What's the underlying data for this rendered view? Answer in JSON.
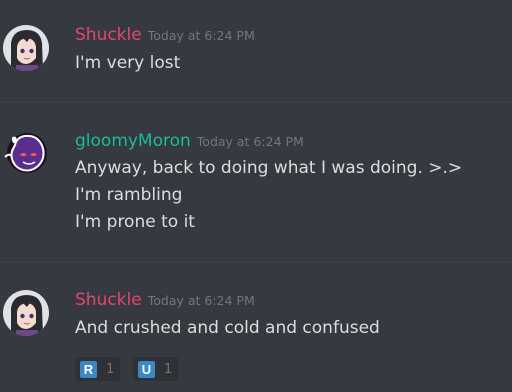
{
  "messages": [
    {
      "username": "Shuckle",
      "username_color": "#e6466e",
      "timestamp": "Today at 6:24 PM",
      "lines": [
        "I'm very lost"
      ]
    },
    {
      "username": "gloomyMoron",
      "username_color": "#1abc9c",
      "timestamp": "Today at 6:24 PM",
      "lines": [
        "Anyway, back to doing what I was doing. >.>",
        "I'm rambling",
        "I'm prone to it"
      ]
    },
    {
      "username": "Shuckle",
      "username_color": "#e6466e",
      "timestamp": "Today at 6:24 PM",
      "lines": [
        "And crushed and cold and confused"
      ],
      "reactions": [
        {
          "emoji_icon": "regional-indicator-r",
          "emoji_letter": "R",
          "count": "1"
        },
        {
          "emoji_icon": "regional-indicator-u",
          "emoji_letter": "U",
          "count": "1"
        }
      ]
    }
  ]
}
